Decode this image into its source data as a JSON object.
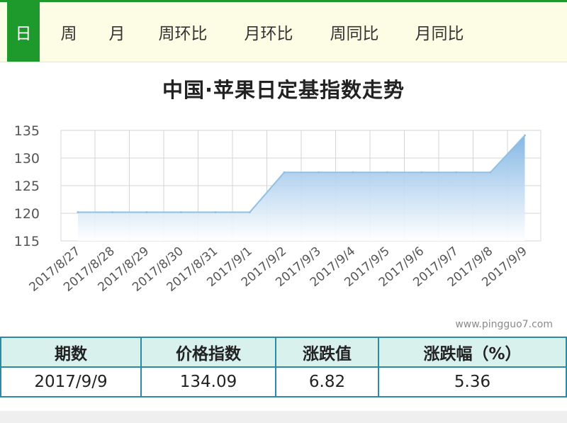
{
  "tabs": [
    {
      "label": "日",
      "active": true
    },
    {
      "label": "周",
      "active": false
    },
    {
      "label": "月",
      "active": false
    },
    {
      "label": "周环比",
      "active": false
    },
    {
      "label": "月环比",
      "active": false
    },
    {
      "label": "周同比",
      "active": false
    },
    {
      "label": "月同比",
      "active": false
    }
  ],
  "colors": {
    "accent": "#1e9a2c",
    "line": "#8fc1e6",
    "table_border": "#2c8aa3",
    "table_header_bg": "#d9f1ec"
  },
  "watermark": "www.pingguo7.com",
  "chart_data": {
    "type": "area",
    "title": "中国·苹果日定基指数走势",
    "xlabel": "",
    "ylabel": "",
    "categories": [
      "2017/8/27",
      "2017/8/28",
      "2017/8/29",
      "2017/8/30",
      "2017/8/31",
      "2017/9/1",
      "2017/9/2",
      "2017/9/3",
      "2017/9/4",
      "2017/9/5",
      "2017/9/6",
      "2017/9/7",
      "2017/9/8",
      "2017/9/9"
    ],
    "values": [
      120.2,
      120.2,
      120.2,
      120.2,
      120.2,
      120.2,
      127.4,
      127.4,
      127.4,
      127.4,
      127.4,
      127.4,
      127.4,
      134.09
    ],
    "ylim": [
      115,
      135
    ],
    "yticks": [
      "115",
      "120",
      "125",
      "130",
      "135"
    ],
    "grid": true,
    "legend": "none"
  },
  "table": {
    "headers": [
      "期数",
      "价格指数",
      "涨跌值",
      "涨跌幅（%）"
    ],
    "rows": [
      [
        "2017/9/9",
        "134.09",
        "6.82",
        "5.36"
      ]
    ]
  }
}
